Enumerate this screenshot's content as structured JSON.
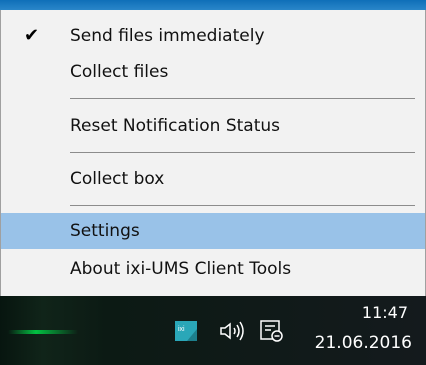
{
  "menu": {
    "items": [
      {
        "id": "send",
        "label": "Send files immediately",
        "checked": true
      },
      {
        "id": "collect",
        "label": "Collect files",
        "checked": false
      },
      {
        "id": "reset",
        "label": "Reset Notification Status",
        "checked": false
      },
      {
        "id": "collectbox",
        "label": "Collect box",
        "checked": false
      },
      {
        "id": "settings",
        "label": "Settings",
        "checked": false,
        "highlighted": true
      },
      {
        "id": "about",
        "label": "About ixi-UMS Client Tools",
        "checked": false
      }
    ],
    "check_glyph": "✔"
  },
  "taskbar": {
    "tray_icons": [
      "ixi-ums-app-icon",
      "speaker-icon",
      "notification-center-icon"
    ],
    "tray_app_icon_text": "ixi",
    "clock": {
      "time": "11:47",
      "date": "21.06.2016"
    }
  },
  "colors": {
    "menu_bg": "#f2f2f2",
    "highlight": "#99c2e8",
    "taskbar_bg": "#141a1d",
    "tray_app_icon": "#2aa7b8"
  }
}
